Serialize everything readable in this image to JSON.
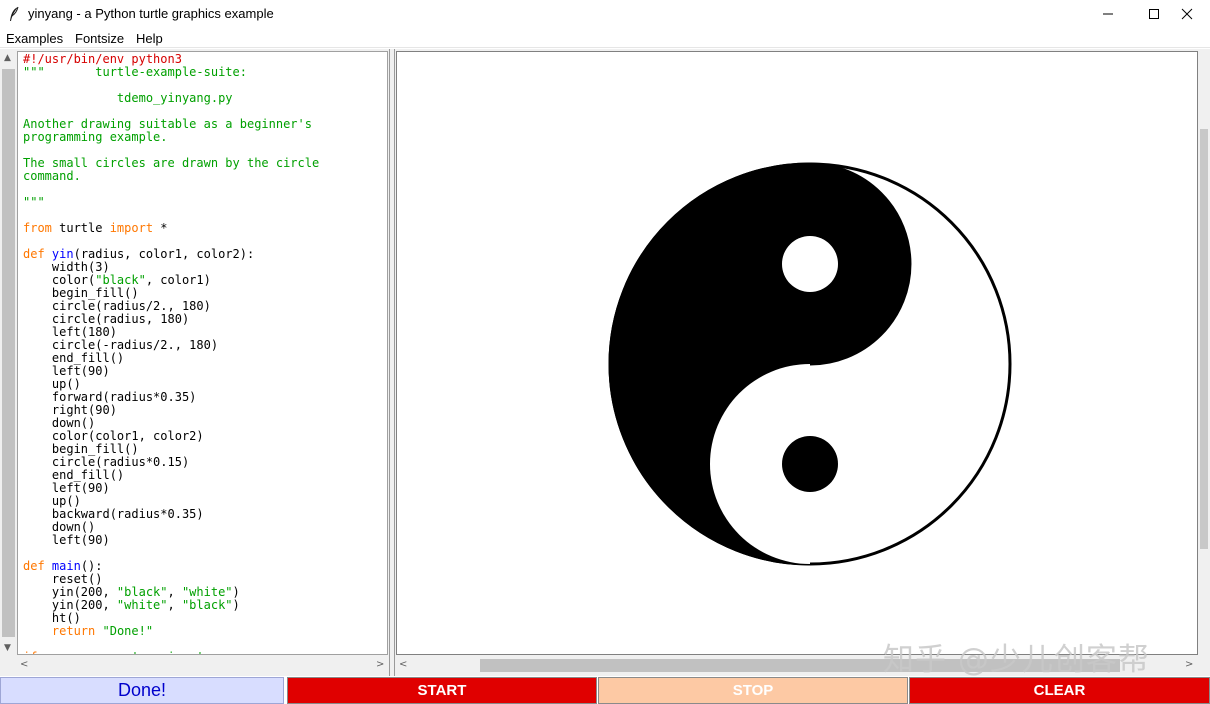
{
  "window": {
    "title": "yinyang - a Python turtle graphics example"
  },
  "menu": {
    "items": [
      "Examples",
      "Fontsize",
      "Help"
    ]
  },
  "code": {
    "lines": [
      [
        {
          "t": "#!/usr/bin/env python3",
          "c": "c"
        }
      ],
      [
        {
          "t": "\"\"\"       turtle-example-suite:",
          "c": "s"
        }
      ],
      [],
      [
        {
          "t": "             tdemo_yinyang.py",
          "c": "s"
        }
      ],
      [],
      [
        {
          "t": "Another drawing suitable as a beginner's",
          "c": "s"
        }
      ],
      [
        {
          "t": "programming example.",
          "c": "s"
        }
      ],
      [],
      [
        {
          "t": "The small circles are drawn by the circle",
          "c": "s"
        }
      ],
      [
        {
          "t": "command.",
          "c": "s"
        }
      ],
      [],
      [
        {
          "t": "\"\"\"",
          "c": "s"
        }
      ],
      [],
      [
        {
          "t": "from",
          "c": "k"
        },
        {
          "t": " turtle ",
          "c": ""
        },
        {
          "t": "import",
          "c": "k"
        },
        {
          "t": " *",
          "c": ""
        }
      ],
      [],
      [
        {
          "t": "def",
          "c": "k"
        },
        {
          "t": " ",
          "c": ""
        },
        {
          "t": "yin",
          "c": "d"
        },
        {
          "t": "(radius, color1, color2):",
          "c": ""
        }
      ],
      [
        {
          "t": "    width(3)",
          "c": ""
        }
      ],
      [
        {
          "t": "    color(",
          "c": ""
        },
        {
          "t": "\"black\"",
          "c": "s"
        },
        {
          "t": ", color1)",
          "c": ""
        }
      ],
      [
        {
          "t": "    begin_fill()",
          "c": ""
        }
      ],
      [
        {
          "t": "    circle(radius/2., 180)",
          "c": ""
        }
      ],
      [
        {
          "t": "    circle(radius, 180)",
          "c": ""
        }
      ],
      [
        {
          "t": "    left(180)",
          "c": ""
        }
      ],
      [
        {
          "t": "    circle(-radius/2., 180)",
          "c": ""
        }
      ],
      [
        {
          "t": "    end_fill()",
          "c": ""
        }
      ],
      [
        {
          "t": "    left(90)",
          "c": ""
        }
      ],
      [
        {
          "t": "    up()",
          "c": ""
        }
      ],
      [
        {
          "t": "    forward(radius*0.35)",
          "c": ""
        }
      ],
      [
        {
          "t": "    right(90)",
          "c": ""
        }
      ],
      [
        {
          "t": "    down()",
          "c": ""
        }
      ],
      [
        {
          "t": "    color(color1, color2)",
          "c": ""
        }
      ],
      [
        {
          "t": "    begin_fill()",
          "c": ""
        }
      ],
      [
        {
          "t": "    circle(radius*0.15)",
          "c": ""
        }
      ],
      [
        {
          "t": "    end_fill()",
          "c": ""
        }
      ],
      [
        {
          "t": "    left(90)",
          "c": ""
        }
      ],
      [
        {
          "t": "    up()",
          "c": ""
        }
      ],
      [
        {
          "t": "    backward(radius*0.35)",
          "c": ""
        }
      ],
      [
        {
          "t": "    down()",
          "c": ""
        }
      ],
      [
        {
          "t": "    left(90)",
          "c": ""
        }
      ],
      [],
      [
        {
          "t": "def",
          "c": "k"
        },
        {
          "t": " ",
          "c": ""
        },
        {
          "t": "main",
          "c": "d"
        },
        {
          "t": "():",
          "c": ""
        }
      ],
      [
        {
          "t": "    reset()",
          "c": ""
        }
      ],
      [
        {
          "t": "    yin(200, ",
          "c": ""
        },
        {
          "t": "\"black\"",
          "c": "s"
        },
        {
          "t": ", ",
          "c": ""
        },
        {
          "t": "\"white\"",
          "c": "s"
        },
        {
          "t": ")",
          "c": ""
        }
      ],
      [
        {
          "t": "    yin(200, ",
          "c": ""
        },
        {
          "t": "\"white\"",
          "c": "s"
        },
        {
          "t": ", ",
          "c": ""
        },
        {
          "t": "\"black\"",
          "c": "s"
        },
        {
          "t": ")",
          "c": ""
        }
      ],
      [
        {
          "t": "    ht()",
          "c": ""
        }
      ],
      [
        {
          "t": "    ",
          "c": ""
        },
        {
          "t": "return",
          "c": "k"
        },
        {
          "t": " ",
          "c": ""
        },
        {
          "t": "\"Done!\"",
          "c": "s"
        }
      ],
      [],
      [
        {
          "t": "if",
          "c": "k"
        },
        {
          "t": " __name__ == ",
          "c": ""
        },
        {
          "t": "'__main__'",
          "c": "s"
        },
        {
          "t": ":",
          "c": ""
        }
      ]
    ]
  },
  "canvas": {
    "drawing": "yin-yang",
    "colors": {
      "dark": "#000000",
      "light": "#ffffff"
    },
    "watermark": "知乎 @少儿创客帮"
  },
  "controls": {
    "status": "Done!",
    "start": "START",
    "stop": "STOP",
    "clear": "CLEAR"
  },
  "colors": {
    "comment": "#d60000",
    "string": "#00a000",
    "keyword": "#ff7700",
    "definition": "#0000ff",
    "button_active": "#e00000",
    "button_disabled": "#fdc9a4",
    "status_bg": "#d8ddff",
    "status_text": "#0000cc"
  }
}
